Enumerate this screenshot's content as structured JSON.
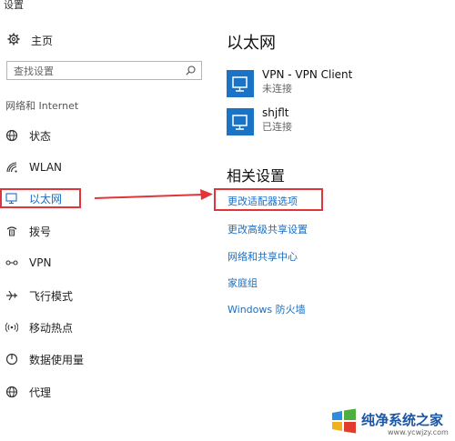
{
  "window": {
    "title": "设置"
  },
  "sidebar": {
    "home_label": "主页",
    "search_placeholder": "查找设置",
    "section_label": "网络和 Internet",
    "items": [
      {
        "label": "状态",
        "icon": "globe-icon"
      },
      {
        "label": "WLAN",
        "icon": "wifi-icon"
      },
      {
        "label": "以太网",
        "icon": "ethernet-icon",
        "selected": true
      },
      {
        "label": "拨号",
        "icon": "dialup-icon"
      },
      {
        "label": "VPN",
        "icon": "vpn-icon"
      },
      {
        "label": "飞行模式",
        "icon": "airplane-icon"
      },
      {
        "label": "移动热点",
        "icon": "hotspot-icon"
      },
      {
        "label": "数据使用量",
        "icon": "data-usage-icon"
      },
      {
        "label": "代理",
        "icon": "proxy-icon"
      }
    ]
  },
  "main": {
    "title": "以太网",
    "connections": [
      {
        "name": "VPN - VPN Client",
        "status": "未连接"
      },
      {
        "name": "shjflt",
        "status": "已连接"
      }
    ],
    "related_title": "相关设置",
    "links": [
      {
        "label": "更改适配器选项",
        "highlighted": true
      },
      {
        "label": "更改高级共享设置"
      },
      {
        "label": "网络和共享中心"
      },
      {
        "label": "家庭组"
      },
      {
        "label": "Windows 防火墙"
      }
    ]
  },
  "watermark": {
    "text": "纯净系统之家",
    "url": "www.ycwjzy.com"
  },
  "colors": {
    "accent": "#1a6fc1",
    "highlight": "#e0353a",
    "icon_blue": "#1a73c5"
  }
}
